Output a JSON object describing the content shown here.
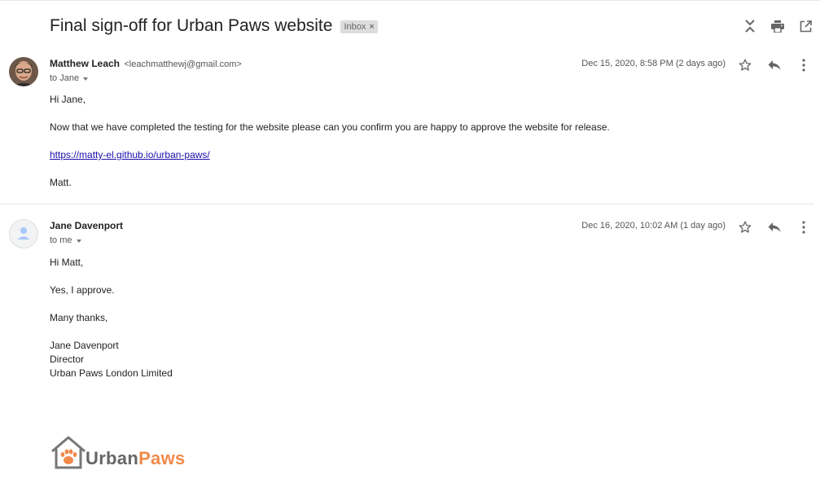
{
  "thread": {
    "subject": "Final sign-off for Urban Paws website",
    "label": "Inbox",
    "label_remove": "×"
  },
  "toolbar": {
    "icons": [
      "collapse-all-icon",
      "print-icon",
      "open-in-new-window-icon"
    ]
  },
  "messages": [
    {
      "sender_name": "Matthew Leach",
      "sender_email": "<leachmatthewj@gmail.com>",
      "to": "to Jane",
      "date": "Dec 15, 2020, 8:58 PM (2 days ago)",
      "body": {
        "greeting": "Hi Jane,",
        "p1": "Now that we have completed the testing for the website please can you confirm you are happy to approve the website for release.",
        "link": "https://matty-el.github.io/urban-paws/",
        "signoff": "Matt."
      }
    },
    {
      "sender_name": "Jane Davenport",
      "to": "to me",
      "date": "Dec 16, 2020, 10:02 AM (1 day ago)",
      "body": {
        "greeting": "Hi Matt,",
        "p1": "Yes, I approve.",
        "p2": "Many thanks,",
        "sig_name": "Jane Davenport",
        "sig_title": "Director",
        "sig_company": "Urban Paws London Limited"
      }
    }
  ],
  "logo": {
    "word1": "Urban",
    "word2": "Paws",
    "color_primary": "#f08a4b",
    "color_secondary": "#666666"
  },
  "colors": {
    "link": "#1a0dab",
    "label_chip_bg": "#dddddd"
  }
}
